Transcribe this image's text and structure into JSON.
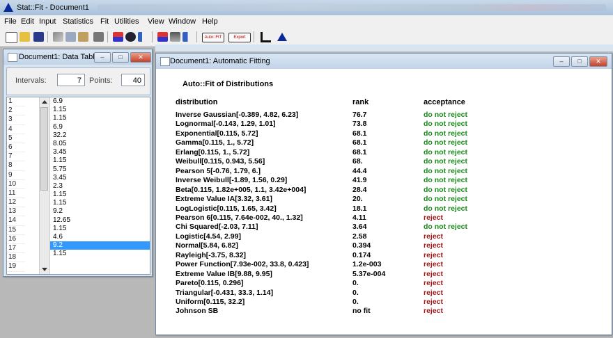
{
  "app": {
    "title": "Stat::Fit - Document1"
  },
  "menu": [
    "File",
    "Edit",
    "Input",
    "Statistics",
    "Fit",
    "Utilities",
    "View",
    "Window",
    "Help"
  ],
  "toolbar": {
    "auto_fit_label": "Auto::FIT",
    "export_label": "Export"
  },
  "data_window": {
    "title": "Document1: Data Table",
    "intervals_label": "Intervals:",
    "intervals_value": "7",
    "points_label": "Points:",
    "points_value": "40",
    "row_numbers": [
      "1",
      "2",
      "3",
      "4",
      "5",
      "6",
      "7",
      "8",
      "9",
      "10",
      "11",
      "12",
      "13",
      "14",
      "15",
      "16",
      "17",
      "18",
      "19"
    ],
    "values": [
      "6.9",
      "1.15",
      "1.15",
      "6.9",
      "32.2",
      "8.05",
      "3.45",
      "1.15",
      "5.75",
      "3.45",
      "2.3",
      "1.15",
      "1.15",
      "9.2",
      "12.65",
      "1.15",
      "4.6",
      "9.2",
      "1.15"
    ],
    "selected_row": 18
  },
  "fit_window": {
    "title": "Document1: Automatic Fitting",
    "heading": "Auto::Fit of Distributions",
    "columns": {
      "distribution": "distribution",
      "rank": "rank",
      "acceptance": "acceptance"
    },
    "rows": [
      {
        "distribution": "Inverse Gaussian[-0.389, 4.82, 6.23]",
        "rank": "76.7",
        "acceptance": "do not reject"
      },
      {
        "distribution": "Lognormal[-0.143, 1.29, 1.01]",
        "rank": "73.8",
        "acceptance": "do not reject"
      },
      {
        "distribution": "Exponential[0.115, 5.72]",
        "rank": "68.1",
        "acceptance": "do not reject"
      },
      {
        "distribution": "Gamma[0.115, 1., 5.72]",
        "rank": "68.1",
        "acceptance": "do not reject"
      },
      {
        "distribution": "Erlang[0.115, 1., 5.72]",
        "rank": "68.1",
        "acceptance": "do not reject"
      },
      {
        "distribution": "Weibull[0.115, 0.943, 5.56]",
        "rank": "68.",
        "acceptance": "do not reject"
      },
      {
        "distribution": "Pearson 5[-0.76, 1.79, 6.]",
        "rank": "44.4",
        "acceptance": "do not reject"
      },
      {
        "distribution": "Inverse Weibull[-1.89, 1.56, 0.29]",
        "rank": "41.9",
        "acceptance": "do not reject"
      },
      {
        "distribution": "Beta[0.115, 1.82e+005, 1.1, 3.42e+004]",
        "rank": "28.4",
        "acceptance": "do not reject"
      },
      {
        "distribution": "Extreme Value IA[3.32, 3.61]",
        "rank": "20.",
        "acceptance": "do not reject"
      },
      {
        "distribution": "LogLogistic[0.115, 1.65, 3.42]",
        "rank": "18.1",
        "acceptance": "do not reject"
      },
      {
        "distribution": "Pearson 6[0.115, 7.64e-002, 40., 1.32]",
        "rank": "4.11",
        "acceptance": "reject"
      },
      {
        "distribution": "Chi Squared[-2.03, 7.11]",
        "rank": "3.64",
        "acceptance": "do not reject"
      },
      {
        "distribution": "Logistic[4.54, 2.99]",
        "rank": "2.58",
        "acceptance": "reject"
      },
      {
        "distribution": "Normal[5.84, 6.82]",
        "rank": "0.394",
        "acceptance": "reject"
      },
      {
        "distribution": "Rayleigh[-3.75, 8.32]",
        "rank": "0.174",
        "acceptance": "reject"
      },
      {
        "distribution": "Power Function[7.93e-002, 33.8, 0.423]",
        "rank": "1.2e-003",
        "acceptance": "reject"
      },
      {
        "distribution": "Extreme Value IB[9.88, 9.95]",
        "rank": "5.37e-004",
        "acceptance": "reject"
      },
      {
        "distribution": "Pareto[0.115, 0.296]",
        "rank": "0.",
        "acceptance": "reject"
      },
      {
        "distribution": "Triangular[-0.431, 33.3, 1.14]",
        "rank": "0.",
        "acceptance": "reject"
      },
      {
        "distribution": "Uniform[0.115, 32.2]",
        "rank": "0.",
        "acceptance": "reject"
      },
      {
        "distribution": "Johnson SB",
        "rank": "no fit",
        "acceptance": "reject"
      }
    ]
  },
  "colors": {
    "accept": "#1a8a1a",
    "reject": "#a01717",
    "selection": "#3399ff",
    "app_icon": "#0a2a9a"
  }
}
